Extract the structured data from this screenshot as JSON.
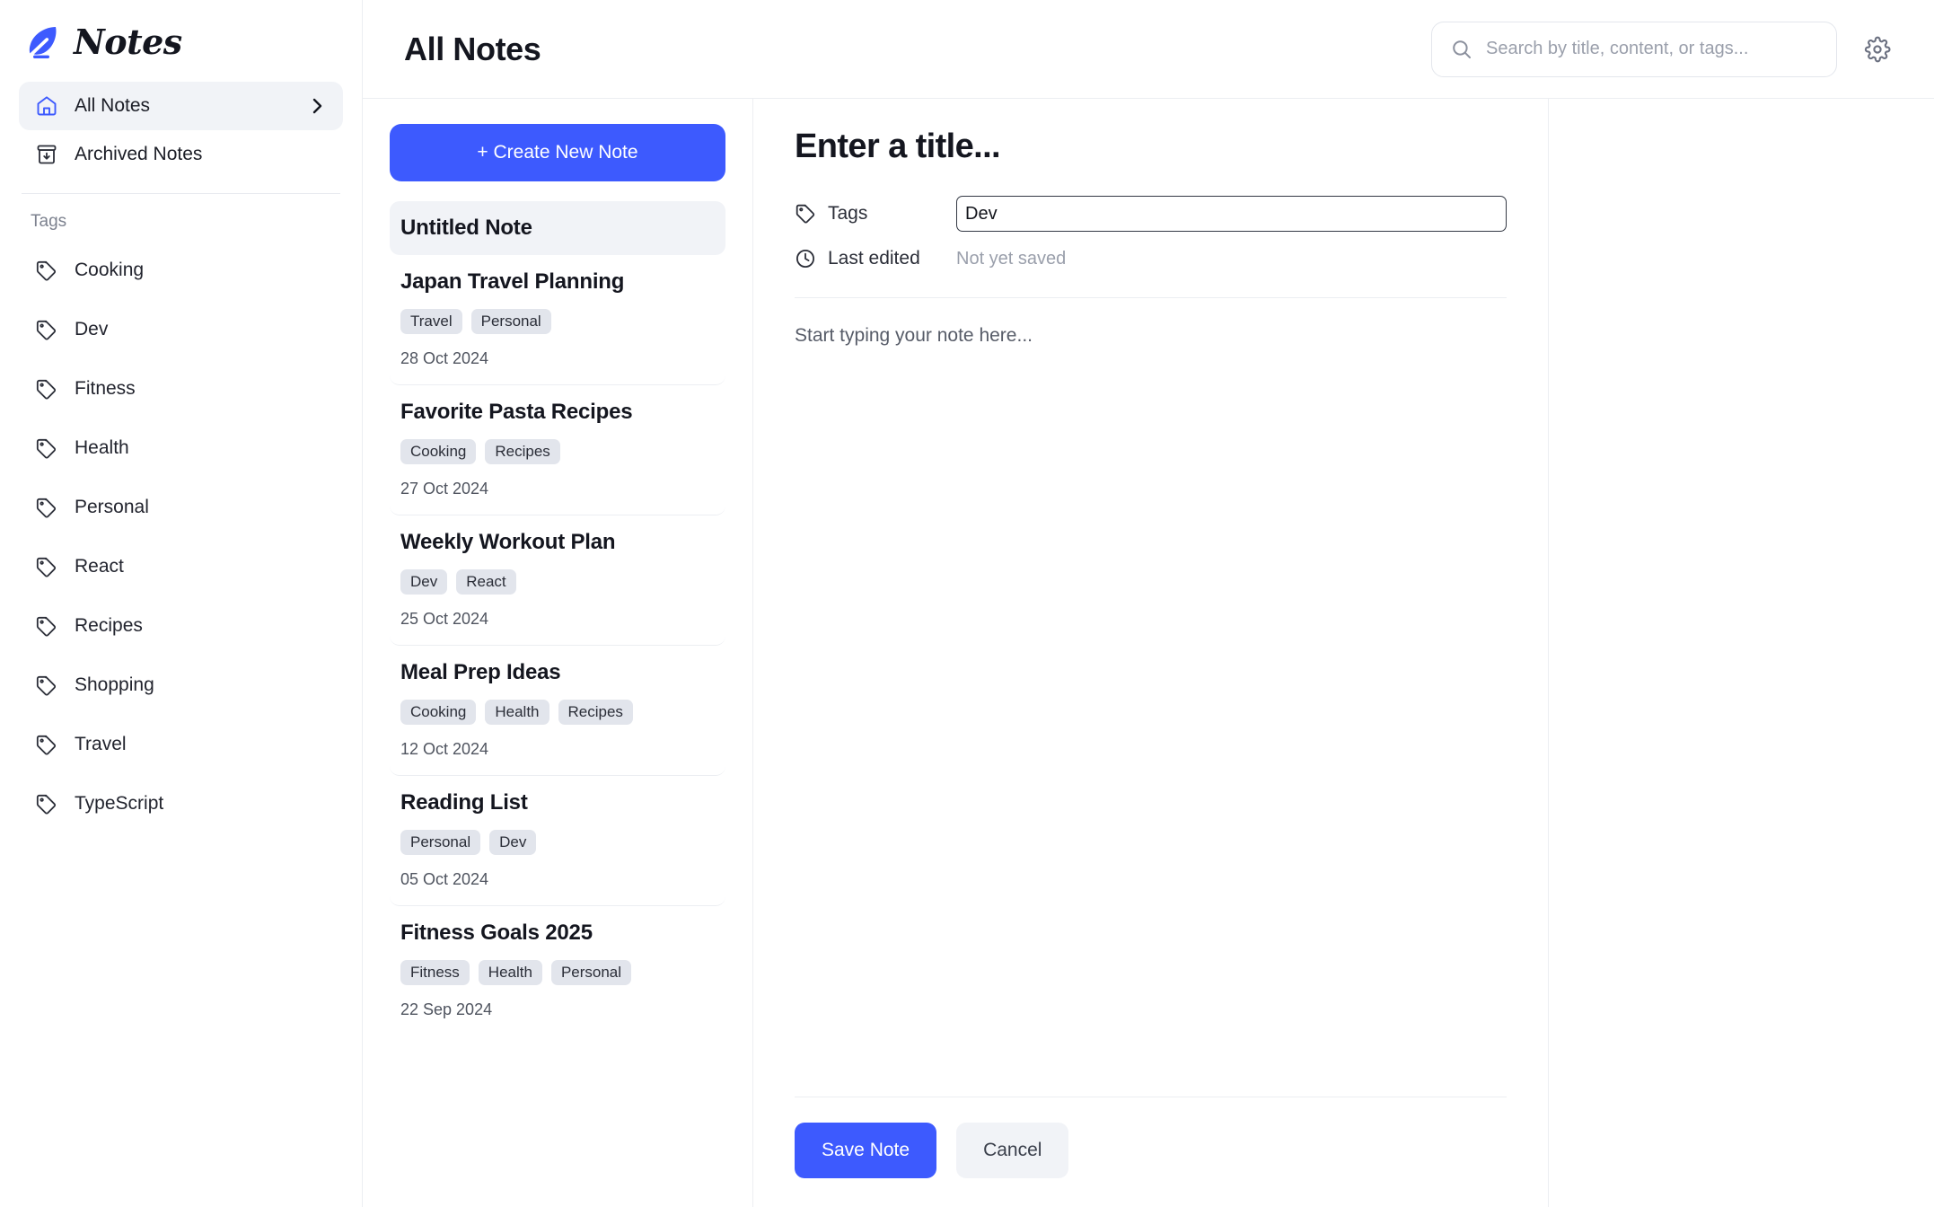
{
  "brand": {
    "name": "Notes",
    "icon": "feather-icon",
    "accent": "#3d5afe"
  },
  "sidebar": {
    "nav": [
      {
        "label": "All Notes",
        "icon": "home-icon",
        "active": true,
        "chevron": "chevron-right-icon"
      },
      {
        "label": "Archived Notes",
        "icon": "archive-icon",
        "active": false
      }
    ],
    "tags_header": "Tags",
    "tags": [
      {
        "label": "Cooking"
      },
      {
        "label": "Dev"
      },
      {
        "label": "Fitness"
      },
      {
        "label": "Health"
      },
      {
        "label": "Personal"
      },
      {
        "label": "React"
      },
      {
        "label": "Recipes"
      },
      {
        "label": "Shopping"
      },
      {
        "label": "Travel"
      },
      {
        "label": "TypeScript"
      }
    ]
  },
  "header": {
    "title": "All Notes",
    "search": {
      "placeholder": "Search by title, content, or tags...",
      "value": "",
      "icon": "search-icon"
    },
    "settings_icon": "gear-icon"
  },
  "notelist": {
    "create_label": "+ Create New Note",
    "notes": [
      {
        "title": "Untitled Note",
        "tags": [],
        "date": "",
        "selected": true
      },
      {
        "title": "Japan Travel Planning",
        "tags": [
          "Travel",
          "Personal"
        ],
        "date": "28 Oct 2024",
        "selected": false
      },
      {
        "title": "Favorite Pasta Recipes",
        "tags": [
          "Cooking",
          "Recipes"
        ],
        "date": "27 Oct 2024",
        "selected": false
      },
      {
        "title": "Weekly Workout Plan",
        "tags": [
          "Dev",
          "React"
        ],
        "date": "25 Oct 2024",
        "selected": false
      },
      {
        "title": "Meal Prep Ideas",
        "tags": [
          "Cooking",
          "Health",
          "Recipes"
        ],
        "date": "12 Oct 2024",
        "selected": false
      },
      {
        "title": "Reading List",
        "tags": [
          "Personal",
          "Dev"
        ],
        "date": "05 Oct 2024",
        "selected": false
      },
      {
        "title": "Fitness Goals 2025",
        "tags": [
          "Fitness",
          "Health",
          "Personal"
        ],
        "date": "22 Sep 2024",
        "selected": false
      }
    ]
  },
  "editor": {
    "title_placeholder": "Enter a title...",
    "title_value": "",
    "tags_label": "Tags",
    "tags_value": "Dev",
    "tags_icon": "tag-icon",
    "lastedited_label": "Last edited",
    "lastedited_value": "Not yet saved",
    "lastedited_icon": "clock-icon",
    "body_placeholder": "Start typing your note here...",
    "body_value": "",
    "save_label": "Save Note",
    "cancel_label": "Cancel"
  }
}
